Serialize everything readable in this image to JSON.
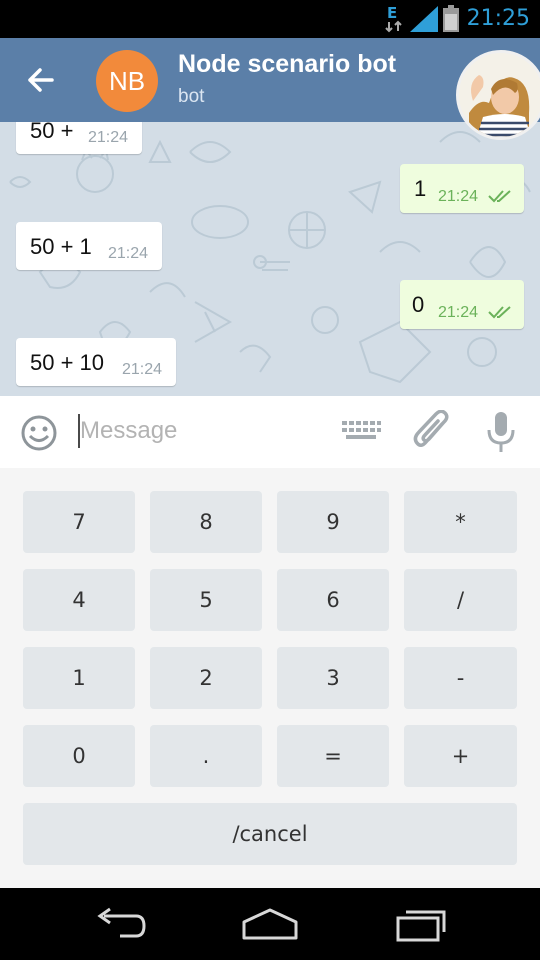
{
  "status_bar": {
    "network_type": "E",
    "time": "21:25",
    "icons": [
      "data-transfer-icon",
      "signal-icon",
      "battery-icon"
    ]
  },
  "header": {
    "avatar_initials": "NB",
    "title": "Node scenario bot",
    "subtitle": "bot",
    "avatar_color": "#f28a3b",
    "background": "#5b7fa8"
  },
  "messages": [
    {
      "direction": "in",
      "text": "50 +",
      "time": "21:24"
    },
    {
      "direction": "out",
      "text": "1",
      "time": "21:24",
      "read": true
    },
    {
      "direction": "in",
      "text": "50 + 1",
      "time": "21:24"
    },
    {
      "direction": "out",
      "text": "0",
      "time": "21:24",
      "read": true
    },
    {
      "direction": "in",
      "text": "50 + 10",
      "time": "21:24"
    }
  ],
  "input": {
    "placeholder": "Message",
    "value": ""
  },
  "keyboard": {
    "rows": [
      [
        "7",
        "8",
        "9",
        "*"
      ],
      [
        "4",
        "5",
        "6",
        "/"
      ],
      [
        "1",
        "2",
        "3",
        "-"
      ],
      [
        "0",
        ".",
        "=",
        "+"
      ],
      [
        "/cancel"
      ]
    ]
  },
  "colors": {
    "accent_time": "#2f9fd8",
    "outgoing_bubble": "#effdde",
    "read_check": "#6bb25a",
    "key_bg": "#e3e7ea"
  }
}
